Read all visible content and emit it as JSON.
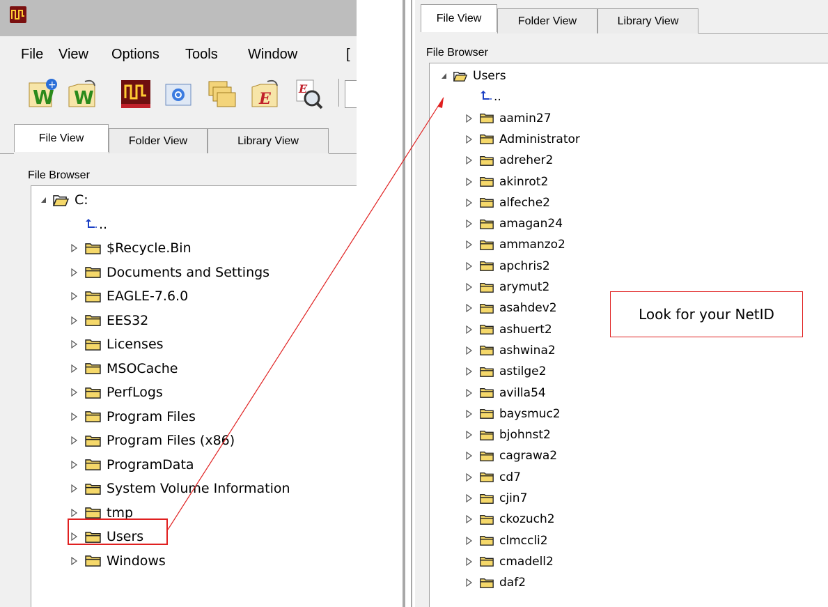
{
  "left": {
    "menu": [
      "File",
      "View",
      "Options",
      "Tools",
      "Window",
      "["
    ],
    "toolbar_icons": [
      "new-project-icon",
      "open-project-icon",
      "run-icon",
      "power-icon",
      "copy-files-icon",
      "open-file-icon",
      "find-icon"
    ],
    "tabs": [
      "File View",
      "Folder View",
      "Library View"
    ],
    "file_browser_label": "File Browser",
    "root": "C:",
    "up": "..",
    "items": [
      "$Recycle.Bin",
      "Documents and Settings",
      "EAGLE-7.6.0",
      "EES32",
      "Licenses",
      "MSOCache",
      "PerfLogs",
      "Program Files",
      "Program Files (x86)",
      "ProgramData",
      "System Volume Information",
      "tmp",
      "Users",
      "Windows"
    ]
  },
  "right": {
    "tabs": [
      "File View",
      "Folder View",
      "Library View"
    ],
    "file_browser_label": "File Browser",
    "root": "Users",
    "up": "..",
    "items": [
      "aamin27",
      "Administrator",
      "adreher2",
      "akinrot2",
      "alfeche2",
      "amagan24",
      "ammanzo2",
      "apchris2",
      "arymut2",
      "asahdev2",
      "ashuert2",
      "ashwina2",
      "astilge2",
      "avilla54",
      "baysmuc2",
      "bjohnst2",
      "cagrawa2",
      "cd7",
      "cjin7",
      "ckozuch2",
      "clmccli2",
      "cmadell2",
      "daf2"
    ]
  },
  "annotation": {
    "note": "Look for your NetID",
    "highlight_color": "#e02020"
  }
}
